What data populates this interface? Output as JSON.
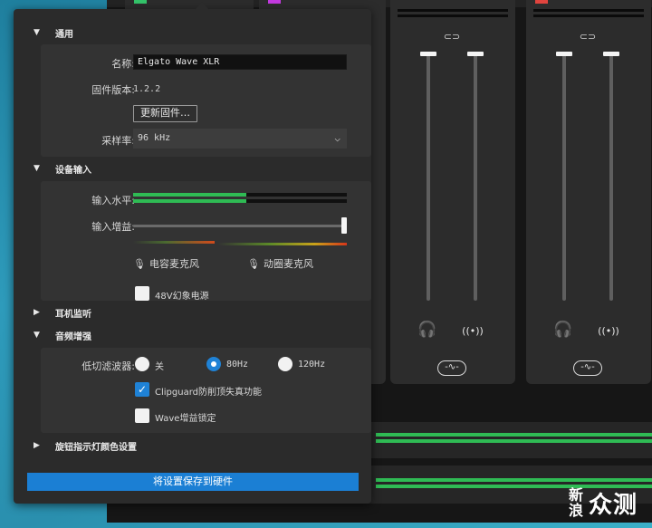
{
  "panel": {
    "sections": {
      "general": {
        "label": "通用",
        "arrow": "▼"
      },
      "device_input": {
        "label": "设备输入",
        "arrow": "▼"
      },
      "headphone": {
        "label": "耳机监听",
        "arrow": "▶"
      },
      "audio_enhance": {
        "label": "音频增强",
        "arrow": "▼"
      },
      "knob_color": {
        "label": "旋钮指示灯颜色设置",
        "arrow": "▶"
      }
    },
    "general": {
      "name_label": "名称:",
      "name_value": "Elgato Wave XLR",
      "firmware_label": "固件版本:",
      "firmware_value": "1.2.2",
      "update_button": "更新固件…",
      "sample_rate_label": "采样率:",
      "sample_rate_value": "96 kHz",
      "chevron": "⌵"
    },
    "device_input": {
      "level_label": "输入水平:",
      "level_fraction": 0.53,
      "gain_label": "输入增益:",
      "gain_fraction": 1.0,
      "condenser_mic": "电容麦克风",
      "dynamic_mic": "动圈麦克风",
      "mic_icon": "🎙",
      "phantom_power": "48V幻象电源",
      "phantom_checked": false
    },
    "audio_enhance": {
      "lowcut_label": "低切滤波器:",
      "options": [
        "关",
        "80Hz",
        "120Hz"
      ],
      "selected_option": "80Hz",
      "clipguard_label": "Clipguard防削顶失真功能",
      "clipguard_checked": true,
      "clipguard_check": "✓",
      "gain_lock_label": "Wave增益锁定",
      "gain_lock_checked": false
    },
    "save_button": "将设置保存到硬件"
  },
  "mixer": {
    "link_icon": "⊂⊃",
    "headphone_icon": "🎧",
    "stream_icon": "((•))",
    "wave_icon": "-∿-"
  },
  "watermark": {
    "small": "新浪",
    "big": "众测"
  },
  "colors": {
    "accent": "#1b7fd4",
    "meter_green": "#2fbb54",
    "panel_bg": "#2b2b2b"
  }
}
